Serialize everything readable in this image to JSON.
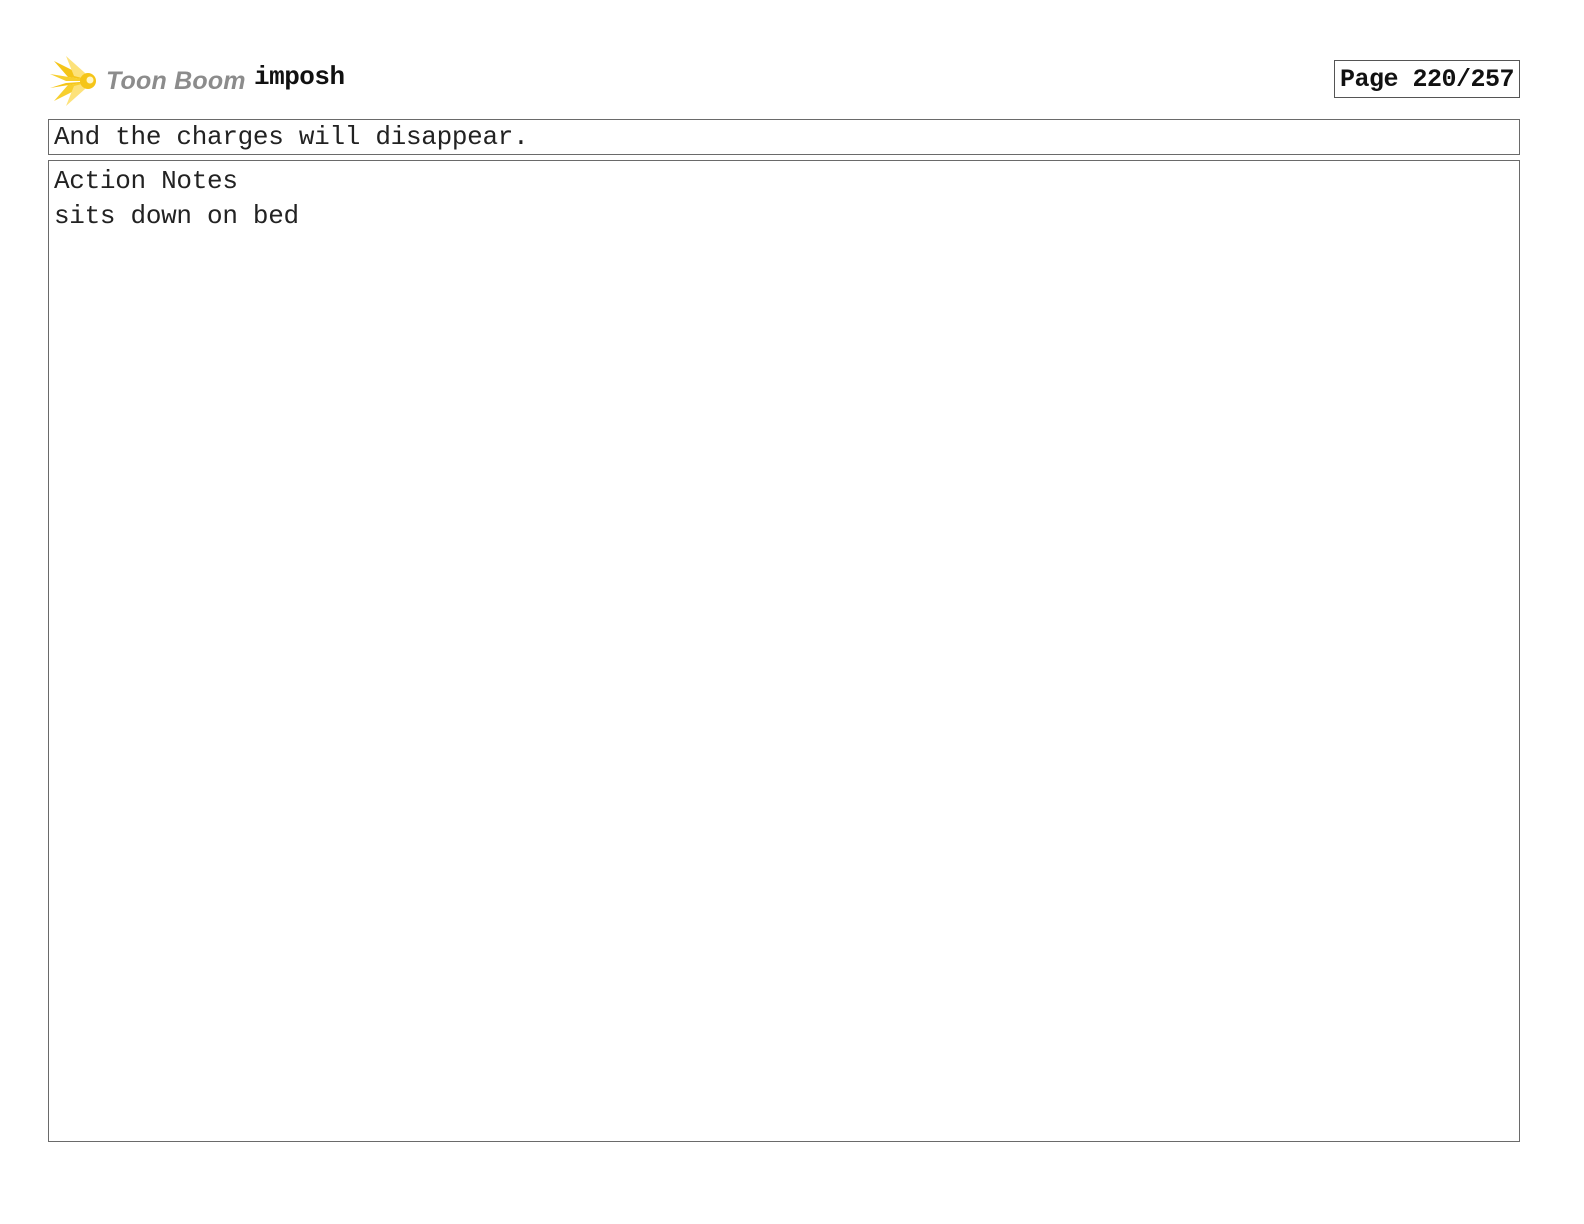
{
  "header": {
    "logo": {
      "brand_text": "Toon Boom",
      "icon": "toon-boom-star-icon",
      "colors": {
        "star": "#f5c518",
        "star_light": "#fde27a",
        "text": "#8c8c8c"
      }
    },
    "project_name": "imposh",
    "page_label": "Page 220/257"
  },
  "dialogue": {
    "text": "And the charges will disappear."
  },
  "notes": {
    "heading": "Action Notes",
    "lines": [
      "sits down on bed"
    ]
  }
}
